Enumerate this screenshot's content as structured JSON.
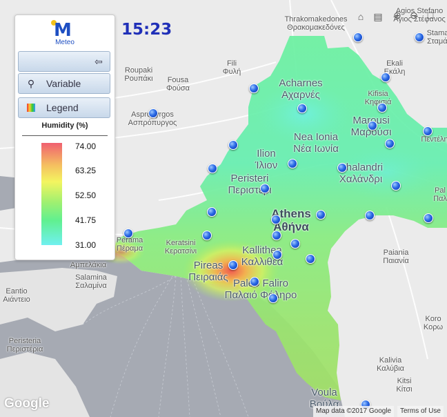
{
  "clock": "15:23",
  "panel": {
    "logo_text": "Meteo",
    "back_icon": "arrow-left-icon",
    "variable_label": "Variable",
    "variable_icon": "search-icon",
    "legend_label": "Legend",
    "legend_icon": "color-gradient-icon",
    "legend_title": "Humidity (%)",
    "ticks": [
      "74.00",
      "63.25",
      "52.50",
      "41.75",
      "31.00"
    ]
  },
  "toolbar": {
    "home_icon": "home-icon",
    "layers_icon": "layers-icon",
    "zoom_in_icon": "zoom-in-icon",
    "zoom_out_icon": "zoom-out-icon",
    "fullscreen_icon": "fullscreen-icon"
  },
  "labels": {
    "agios_stefanos": "Agios Stefano",
    "agios_stefanos_gr": "Άγιος Στέφανος",
    "thrakomakedones": "Thrakomakedones",
    "thrakomakedones_gr": "Θρακομακεδόνες",
    "stamata": "Stamat",
    "stamata_gr": "Σταμάτ",
    "fili": "Fili",
    "fili_gr": "Φυλή",
    "ekali": "Ekali",
    "ekali_gr": "Εκάλη",
    "roupaki": "Roupaki",
    "roupaki_gr": "Ρουπάκι",
    "fousa": "Fousa",
    "fousa_gr": "Φούσα",
    "acharnes": "Acharnes",
    "acharnes_gr": "Αχαρνές",
    "kifisia": "Kifisia",
    "kifisia_gr": "Κηφισιά",
    "aspropyrgos": "Aspropyrgos",
    "aspropyrgos_gr": "Ασπρόπυργος",
    "marousi": "Marousi",
    "marousi_gr": "Μαρούσι",
    "penteli_gr": "Πεντέλη",
    "nea_ionia": "Nea Ionia",
    "nea_ionia_gr": "Νέα Ιωνία",
    "ilion": "Ilion",
    "ilion_gr": "Ίλιον",
    "chalandri": "Chalandri",
    "chalandri_gr": "Χαλάνδρι",
    "peristeri": "Peristeri",
    "peristeri_gr": "Περιστέρι",
    "pal": "Pal",
    "pal_gr": "Παλ",
    "athens": "Athens",
    "athens_gr": "Αθήνα",
    "perama": "Perama",
    "perama_gr": "Πέραμα",
    "keratsini": "Keratsini",
    "keratsini_gr": "Κερατσίνι",
    "kallithea": "Kallithea",
    "kallithea_gr": "Καλλιθέα",
    "ampelakia_gr": "Αμπελάκια",
    "pireas": "Pireas",
    "pireas_gr": "Πειραιάς",
    "paleo_faliro": "Paleo Faliro",
    "paleo_faliro_gr": "Παλαιό Φάληρο",
    "paiania": "Paiania",
    "paiania_gr": "Παιανία",
    "salamina": "Salamina",
    "salamina_gr": "Σαλαμίνα",
    "eantio": "Eantio",
    "eantio_gr": "Αιάντειο",
    "korop": "Koro",
    "korop_gr": "Κορω",
    "peristeria": "Peristeria",
    "peristeria_gr": "Περιστέρια",
    "kalyvia": "Kalivia",
    "kalyvia_gr": "Καλύβια",
    "kitsi": "Kitsi",
    "kitsi_gr": "Κίτσι",
    "voula": "Voula",
    "voula_gr": "Βούλα"
  },
  "google": "Google",
  "attribution": {
    "map_data": "Map data ©2017 Google",
    "terms": "Terms of Use"
  }
}
